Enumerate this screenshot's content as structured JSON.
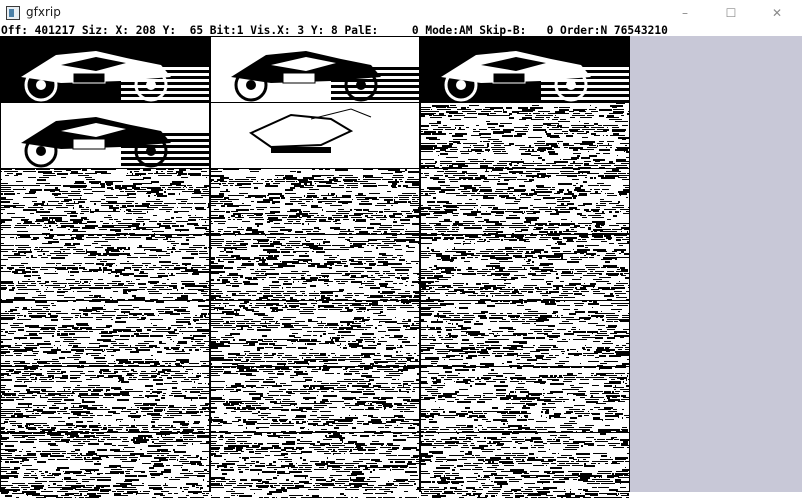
{
  "window": {
    "title": "gfxrip",
    "minimize_symbol": "–",
    "maximize_symbol": "☐",
    "close_symbol": "✕"
  },
  "status": {
    "text": "Off: 401217 Siz: X: 208 Y:  65 Bit:1 Vis.X: 3 Y: 8 PalE:     0 Mode:AM Skip-B:   0 Order:N 76543210"
  },
  "colors": {
    "panel": "#c8c8d7",
    "pixel_on": "#000000",
    "pixel_off": "#ffffff"
  },
  "grid": {
    "columns": 3,
    "rows": 7
  },
  "tiles": [
    {
      "kind": "bike-dark"
    },
    {
      "kind": "bike-light"
    },
    {
      "kind": "bike-dark"
    },
    {
      "kind": "bike-light"
    },
    {
      "kind": "bike-faint"
    },
    {
      "kind": "noise"
    },
    {
      "kind": "noise"
    },
    {
      "kind": "noise"
    },
    {
      "kind": "noise"
    },
    {
      "kind": "noise"
    },
    {
      "kind": "noise"
    },
    {
      "kind": "noise"
    },
    {
      "kind": "noise"
    },
    {
      "kind": "noise"
    },
    {
      "kind": "noise"
    },
    {
      "kind": "noise"
    },
    {
      "kind": "noise"
    },
    {
      "kind": "noise"
    },
    {
      "kind": "noise"
    },
    {
      "kind": "noise"
    },
    {
      "kind": "noise"
    }
  ]
}
